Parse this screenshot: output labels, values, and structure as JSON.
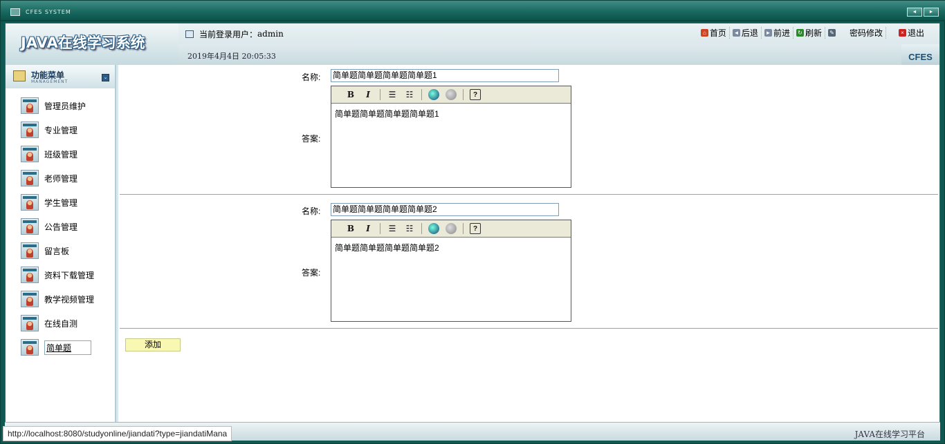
{
  "window": {
    "title": "CFES SYSTEM",
    "buttons": [
      "◄",
      "►"
    ]
  },
  "header": {
    "logo": "JAVA在线学习系统",
    "current_user_label": "当前登录用户：",
    "current_user": "admin",
    "datetime": "2019年4月4日  20:05:33",
    "brand": "CFES",
    "nav": [
      {
        "label": "首页",
        "icon": "home-icon",
        "color": "#cc4422"
      },
      {
        "label": "后退",
        "icon": "back-icon",
        "color": "#7a8aa0"
      },
      {
        "label": "前进",
        "icon": "forward-icon",
        "color": "#7a8aa0"
      },
      {
        "label": "刷新",
        "icon": "refresh-icon",
        "color": "#2a8a2a"
      },
      {
        "label": "密码修改",
        "icon": "edit-icon",
        "color": "#556677"
      },
      {
        "label": "退出",
        "icon": "exit-icon",
        "color": "#cc2222"
      }
    ]
  },
  "sidebar": {
    "title": "功能菜单",
    "subtitle": "MANAGEMENT",
    "items": [
      {
        "label": "管理员维护"
      },
      {
        "label": "专业管理"
      },
      {
        "label": "班级管理"
      },
      {
        "label": "老师管理"
      },
      {
        "label": "学生管理"
      },
      {
        "label": "公告管理"
      },
      {
        "label": "留言板"
      },
      {
        "label": "资料下载管理"
      },
      {
        "label": "教学视频管理"
      },
      {
        "label": "在线自测"
      },
      {
        "label": "简单题"
      }
    ]
  },
  "main": {
    "name_label": "名称:",
    "answer_label": "答案:",
    "questions": [
      {
        "name": "简单题简单题简单题简单题1",
        "answer": "简单题简单题简单题简单题1"
      },
      {
        "name": "简单题简单题简单题简单题2",
        "answer": "简单题简单题简单题简单题2"
      }
    ],
    "toolbar": {
      "bold": "B",
      "italic": "I",
      "help": "?"
    },
    "add_button": "添加"
  },
  "status": {
    "url": "http://localhost:8080/studyonline/jiandati?type=jiandatiMana",
    "platform": "JAVA在线学习平台"
  }
}
